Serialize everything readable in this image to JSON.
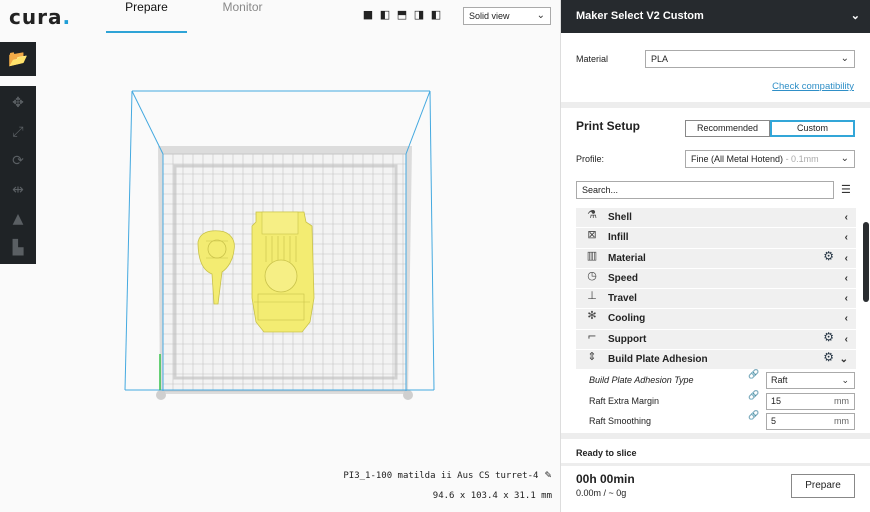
{
  "app": {
    "logo_text": "cura",
    "logo_dot": ".",
    "accent": "#2ea3d6"
  },
  "tabs": [
    {
      "label": "Prepare",
      "active": true
    },
    {
      "label": "Monitor",
      "active": false
    }
  ],
  "view": {
    "icons": [
      "3d-view-icon",
      "front-view-icon",
      "top-view-icon",
      "left-view-icon",
      "right-view-icon"
    ],
    "mode": "Solid view"
  },
  "toolbar": {
    "open_icon": "folder-open-icon",
    "tools": [
      "move-tool-icon",
      "scale-tool-icon",
      "rotate-tool-icon",
      "mirror-tool-icon",
      "per-model-settings-icon",
      "support-blocker-icon"
    ]
  },
  "object": {
    "name": "PI3_1-100 matilda ii Aus CS turret-4",
    "dimensions": "94.6 x 103.4 x 31.1 mm"
  },
  "panel": {
    "printer": "Maker Select V2 Custom",
    "material_label": "Material",
    "material_value": "PLA",
    "check_compat": "Check compatibility",
    "setup_title": "Print Setup",
    "mode_recommended": "Recommended",
    "mode_custom": "Custom",
    "profile_label": "Profile:",
    "profile_value": "Fine (All Metal Hotend)",
    "profile_layer": "- 0.1mm",
    "search_placeholder": "Search...",
    "categories": [
      {
        "name": "Shell",
        "icon": "shell-icon",
        "gear": false,
        "expanded": false
      },
      {
        "name": "Infill",
        "icon": "infill-icon",
        "gear": false,
        "expanded": false
      },
      {
        "name": "Material",
        "icon": "material-icon",
        "gear": true,
        "expanded": false
      },
      {
        "name": "Speed",
        "icon": "speed-icon",
        "gear": false,
        "expanded": false
      },
      {
        "name": "Travel",
        "icon": "travel-icon",
        "gear": false,
        "expanded": false
      },
      {
        "name": "Cooling",
        "icon": "cooling-icon",
        "gear": false,
        "expanded": false
      },
      {
        "name": "Support",
        "icon": "support-icon",
        "gear": true,
        "expanded": false
      },
      {
        "name": "Build Plate Adhesion",
        "icon": "adhesion-icon",
        "gear": true,
        "expanded": true
      }
    ],
    "adhesion_settings": [
      {
        "name": "Build Plate Adhesion Type",
        "value": "Raft",
        "unit": "",
        "dropdown": true,
        "italic": true
      },
      {
        "name": "Raft Extra Margin",
        "value": "15",
        "unit": "mm",
        "dropdown": false,
        "italic": false
      },
      {
        "name": "Raft Smoothing",
        "value": "5",
        "unit": "mm",
        "dropdown": false,
        "italic": false
      }
    ],
    "ready_text": "Ready to slice",
    "time_text": "00h 00min",
    "usage_text": "0.00m / ~ 0g",
    "prepare_button": "Prepare"
  }
}
